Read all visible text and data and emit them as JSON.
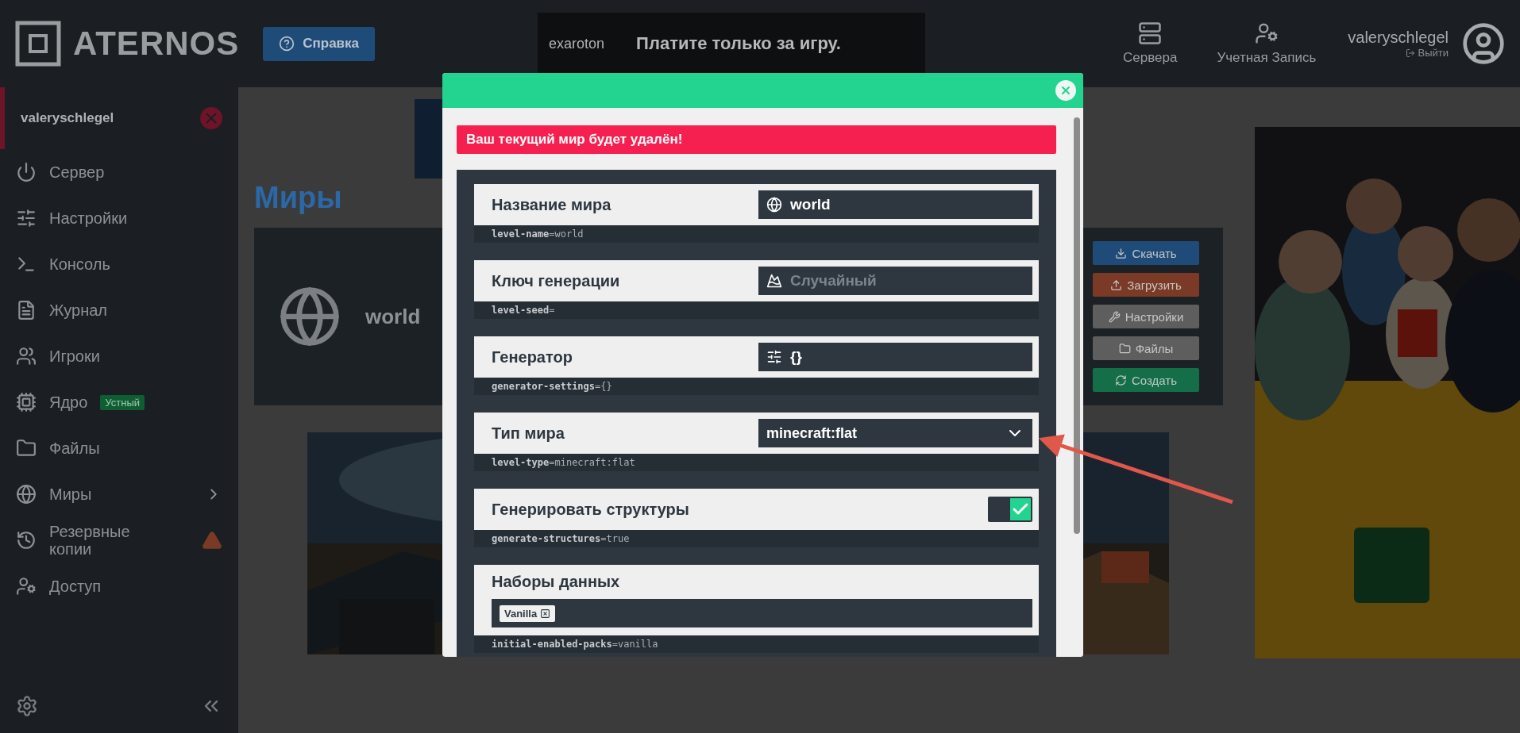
{
  "header": {
    "logo": "ATERNOS",
    "help_button": "Справка",
    "ad": {
      "brand": "exaroton",
      "headline": "Платите только за игру."
    },
    "nav": [
      {
        "label": "Сервера"
      },
      {
        "label": "Учетная Запись"
      }
    ],
    "user": {
      "name": "valeryschlegel",
      "logout": "Выйти"
    }
  },
  "sidebar": {
    "server_name": "valeryschlegel",
    "items": [
      {
        "label": "Сервер",
        "submenu": false,
        "warning": false
      },
      {
        "label": "Настройки",
        "submenu": false,
        "warning": false
      },
      {
        "label": "Консоль",
        "submenu": false,
        "warning": false
      },
      {
        "label": "Журнал",
        "submenu": false,
        "warning": false
      },
      {
        "label": "Игроки",
        "submenu": false,
        "warning": false
      },
      {
        "label": "Ядро",
        "badge": "Устный",
        "submenu": false,
        "warning": false
      },
      {
        "label": "Файлы",
        "submenu": false,
        "warning": false
      },
      {
        "label": "Миры",
        "submenu": true,
        "warning": false
      },
      {
        "label": "Резервные копии",
        "submenu": false,
        "warning": true
      },
      {
        "label": "Доступ",
        "submenu": false,
        "warning": false
      }
    ]
  },
  "main": {
    "title": "Миры",
    "world": {
      "name": "world"
    },
    "actions": [
      {
        "label": "Скачать",
        "color": "#1f4b78"
      },
      {
        "label": "Загрузить",
        "color": "#7a3a26"
      },
      {
        "label": "Настройки",
        "color": "#5e5e5e"
      },
      {
        "label": "Файлы",
        "color": "#5e5e5e"
      },
      {
        "label": "Создать",
        "color": "#146e48"
      }
    ]
  },
  "modal": {
    "alert": "Ваш текущий мир будет удалён!",
    "settings": [
      {
        "kind": "input",
        "label": "Название мира",
        "value": "world",
        "property": "**level-name**=world"
      },
      {
        "kind": "input",
        "label": "Ключ генерации",
        "placeholder": "Случайный",
        "property": "**level-seed**="
      },
      {
        "kind": "input",
        "label": "Генератор",
        "value": "{}",
        "property": "**generator-settings**={}"
      },
      {
        "kind": "select",
        "label": "Тип мира",
        "value": "minecraft:flat",
        "property": "**level-type**=minecraft:flat"
      },
      {
        "kind": "toggle",
        "label": "Генерировать структуры",
        "on": true,
        "property": "**generate-structures**=true"
      },
      {
        "kind": "tags",
        "label": "Наборы данных",
        "tags": [
          "Vanilla"
        ],
        "property": "**initial-enabled-packs**=vanilla"
      }
    ]
  }
}
